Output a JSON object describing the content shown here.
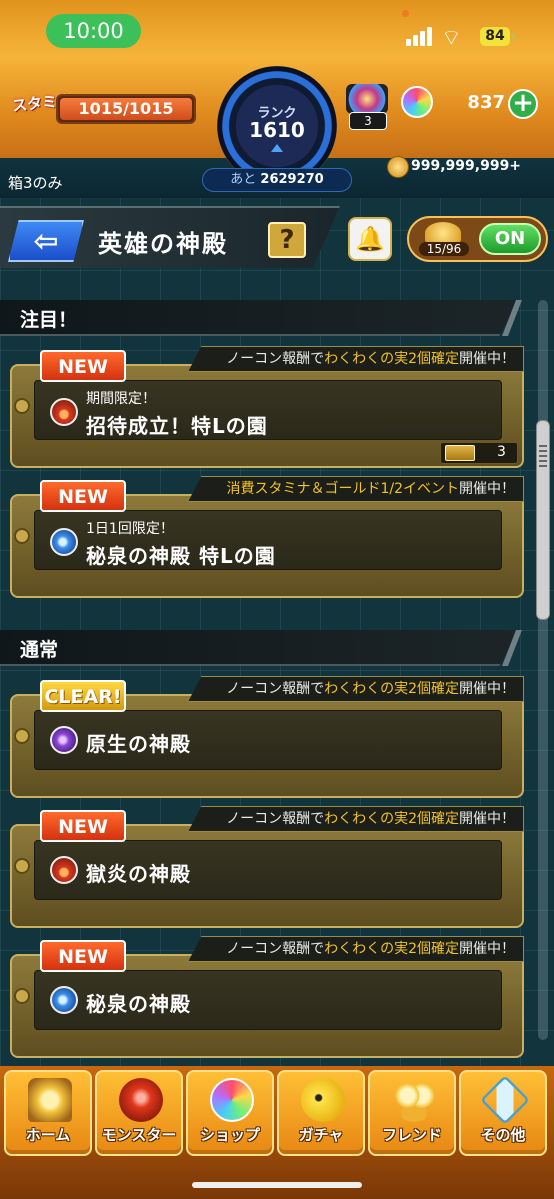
{
  "status_bar": {
    "time": "10:00",
    "battery": "84"
  },
  "player": {
    "stamina_label": "スタミナ",
    "stamina": "1015/1015",
    "stamina_fraction": 1.0,
    "rank_label": "ランク",
    "rank": "1610",
    "rank_next_prefix": "あと",
    "rank_next_value": "2629270",
    "box_count": "3",
    "orbs": "837",
    "gold": "999,999,999+",
    "box_note": "箱3のみ"
  },
  "header": {
    "back_icon": "back-arrow-icon",
    "title": "英雄の神殿",
    "help_label": "?",
    "counter": "15/96",
    "toggle_label": "ON"
  },
  "sections": {
    "featured": "注目！",
    "normal": "通常"
  },
  "cards": [
    {
      "badge": "NEW",
      "banner_pre": "ノーコン報酬で",
      "banner_hl": "わくわくの実2個確定",
      "banner_post": "開催中！",
      "element": "fire",
      "subtitle": "期間限定！",
      "title": "招待成立！特Lの園",
      "ticket_count": "3"
    },
    {
      "badge": "NEW",
      "banner_pre": "",
      "banner_hl": "消費スタミナ＆ゴールド1/2イベント",
      "banner_post": "開催中！",
      "element": "water",
      "subtitle": "1日1回限定！",
      "title": "秘泉の神殿 特Lの園"
    },
    {
      "badge": "CLEAR!",
      "banner_pre": "ノーコン報酬で",
      "banner_hl": "わくわくの実2個確定",
      "banner_post": "開催中！",
      "element": "dark",
      "title": "原生の神殿"
    },
    {
      "badge": "NEW",
      "banner_pre": "ノーコン報酬で",
      "banner_hl": "わくわくの実2個確定",
      "banner_post": "開催中！",
      "element": "fire",
      "title": "獄炎の神殿"
    },
    {
      "badge": "NEW",
      "banner_pre": "ノーコン報酬で",
      "banner_hl": "わくわくの実2個確定",
      "banner_post": "開催中！",
      "element": "water",
      "title": "秘泉の神殿"
    }
  ],
  "nav": [
    {
      "label": "ホーム",
      "icon": "home-gate-icon"
    },
    {
      "label": "モンスター",
      "icon": "monster-icon"
    },
    {
      "label": "ショップ",
      "icon": "orb-shop-icon"
    },
    {
      "label": "ガチャ",
      "icon": "gacha-icon"
    },
    {
      "label": "フレンド",
      "icon": "friends-icon"
    },
    {
      "label": "その他",
      "icon": "other-icon"
    }
  ],
  "colors": {
    "accent_orange": "#f6b43a",
    "new_badge": "#ff6a2c",
    "highlight_text": "#f3c320",
    "toggle_on": "#2fae4a"
  }
}
